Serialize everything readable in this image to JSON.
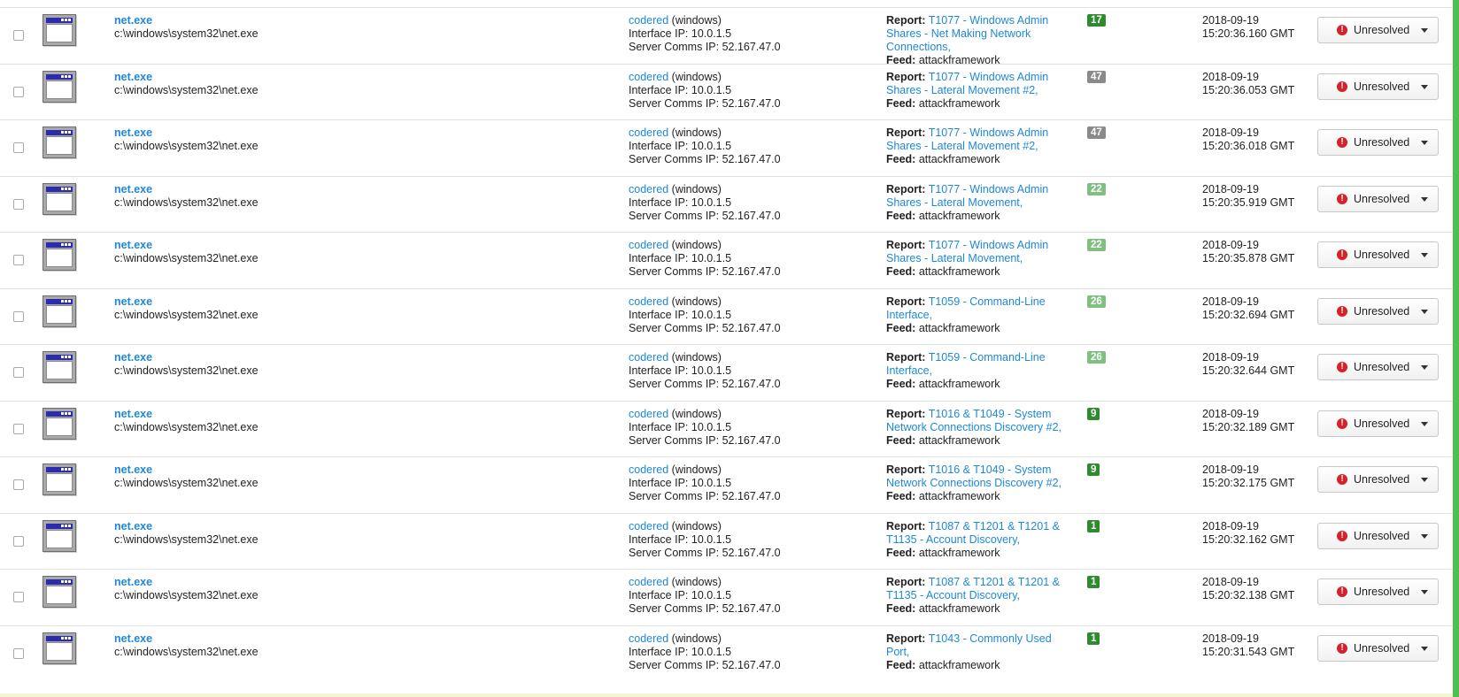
{
  "colors": {
    "link": "#1e88d8",
    "severity_high": "#2e8b2e",
    "severity_low": "#7fbf7f",
    "severity_gray": "#8a8a8a",
    "alert_red": "#d6202a",
    "right_border": "#4fbf4f"
  },
  "labels": {
    "report_prefix": "Report:",
    "feed_prefix": "Feed:",
    "iface_prefix": "Interface IP: ",
    "comms_prefix": "Server Comms IP: "
  },
  "rows": [
    {
      "process": "net.exe",
      "path": "c:\\windows\\system32\\net.exe",
      "host": "codered",
      "os": "(windows)",
      "interface_ip": "10.0.1.5",
      "comms_ip": "52.167.47.0",
      "report": [
        "T1077 - Windows Admin",
        "Shares - Net Making Network",
        "Connections,"
      ],
      "feed": "attackframework",
      "score": "17",
      "score_color": "#2e8b2e",
      "date": "2018-09-19",
      "time": "15:20:36.160 GMT",
      "status": "Unresolved"
    },
    {
      "process": "net.exe",
      "path": "c:\\windows\\system32\\net.exe",
      "host": "codered",
      "os": "(windows)",
      "interface_ip": "10.0.1.5",
      "comms_ip": "52.167.47.0",
      "report": [
        "T1077 - Windows Admin",
        "Shares - Lateral Movement #2,"
      ],
      "feed": "attackframework",
      "score": "47",
      "score_color": "#8a8a8a",
      "date": "2018-09-19",
      "time": "15:20:36.053 GMT",
      "status": "Unresolved"
    },
    {
      "process": "net.exe",
      "path": "c:\\windows\\system32\\net.exe",
      "host": "codered",
      "os": "(windows)",
      "interface_ip": "10.0.1.5",
      "comms_ip": "52.167.47.0",
      "report": [
        "T1077 - Windows Admin",
        "Shares - Lateral Movement #2,"
      ],
      "feed": "attackframework",
      "score": "47",
      "score_color": "#8a8a8a",
      "date": "2018-09-19",
      "time": "15:20:36.018 GMT",
      "status": "Unresolved"
    },
    {
      "process": "net.exe",
      "path": "c:\\windows\\system32\\net.exe",
      "host": "codered",
      "os": "(windows)",
      "interface_ip": "10.0.1.5",
      "comms_ip": "52.167.47.0",
      "report": [
        "T1077 - Windows Admin",
        "Shares - Lateral Movement,"
      ],
      "feed": "attackframework",
      "score": "22",
      "score_color": "#7fbf7f",
      "date": "2018-09-19",
      "time": "15:20:35.919 GMT",
      "status": "Unresolved"
    },
    {
      "process": "net.exe",
      "path": "c:\\windows\\system32\\net.exe",
      "host": "codered",
      "os": "(windows)",
      "interface_ip": "10.0.1.5",
      "comms_ip": "52.167.47.0",
      "report": [
        "T1077 - Windows Admin",
        "Shares - Lateral Movement,"
      ],
      "feed": "attackframework",
      "score": "22",
      "score_color": "#7fbf7f",
      "date": "2018-09-19",
      "time": "15:20:35.878 GMT",
      "status": "Unresolved"
    },
    {
      "process": "net.exe",
      "path": "c:\\windows\\system32\\net.exe",
      "host": "codered",
      "os": "(windows)",
      "interface_ip": "10.0.1.5",
      "comms_ip": "52.167.47.0",
      "report": [
        "T1059 - Command-Line",
        "Interface,"
      ],
      "feed": "attackframework",
      "score": "26",
      "score_color": "#7fbf7f",
      "date": "2018-09-19",
      "time": "15:20:32.694 GMT",
      "status": "Unresolved"
    },
    {
      "process": "net.exe",
      "path": "c:\\windows\\system32\\net.exe",
      "host": "codered",
      "os": "(windows)",
      "interface_ip": "10.0.1.5",
      "comms_ip": "52.167.47.0",
      "report": [
        "T1059 - Command-Line",
        "Interface,"
      ],
      "feed": "attackframework",
      "score": "26",
      "score_color": "#7fbf7f",
      "date": "2018-09-19",
      "time": "15:20:32.644 GMT",
      "status": "Unresolved"
    },
    {
      "process": "net.exe",
      "path": "c:\\windows\\system32\\net.exe",
      "host": "codered",
      "os": "(windows)",
      "interface_ip": "10.0.1.5",
      "comms_ip": "52.167.47.0",
      "report": [
        "T1016 & T1049 - System",
        "Network Connections Discovery #2,"
      ],
      "feed": "attackframework",
      "score": "9",
      "score_color": "#2e8b2e",
      "date": "2018-09-19",
      "time": "15:20:32.189 GMT",
      "status": "Unresolved"
    },
    {
      "process": "net.exe",
      "path": "c:\\windows\\system32\\net.exe",
      "host": "codered",
      "os": "(windows)",
      "interface_ip": "10.0.1.5",
      "comms_ip": "52.167.47.0",
      "report": [
        "T1016 & T1049 - System",
        "Network Connections Discovery #2,"
      ],
      "feed": "attackframework",
      "score": "9",
      "score_color": "#2e8b2e",
      "date": "2018-09-19",
      "time": "15:20:32.175 GMT",
      "status": "Unresolved"
    },
    {
      "process": "net.exe",
      "path": "c:\\windows\\system32\\net.exe",
      "host": "codered",
      "os": "(windows)",
      "interface_ip": "10.0.1.5",
      "comms_ip": "52.167.47.0",
      "report": [
        "T1087 & T1201 & T1201 &",
        "T1135 - Account Discovery,"
      ],
      "feed": "attackframework",
      "score": "1",
      "score_color": "#2e8b2e",
      "date": "2018-09-19",
      "time": "15:20:32.162 GMT",
      "status": "Unresolved"
    },
    {
      "process": "net.exe",
      "path": "c:\\windows\\system32\\net.exe",
      "host": "codered",
      "os": "(windows)",
      "interface_ip": "10.0.1.5",
      "comms_ip": "52.167.47.0",
      "report": [
        "T1087 & T1201 & T1201 &",
        "T1135 - Account Discovery,"
      ],
      "feed": "attackframework",
      "score": "1",
      "score_color": "#2e8b2e",
      "date": "2018-09-19",
      "time": "15:20:32.138 GMT",
      "status": "Unresolved"
    },
    {
      "process": "net.exe",
      "path": "c:\\windows\\system32\\net.exe",
      "host": "codered",
      "os": "(windows)",
      "interface_ip": "10.0.1.5",
      "comms_ip": "52.167.47.0",
      "report": [
        "T1043 - Commonly Used",
        "Port,"
      ],
      "feed": "attackframework",
      "score": "1",
      "score_color": "#2e8b2e",
      "date": "2018-09-19",
      "time": "15:20:31.543 GMT",
      "status": "Unresolved"
    }
  ]
}
